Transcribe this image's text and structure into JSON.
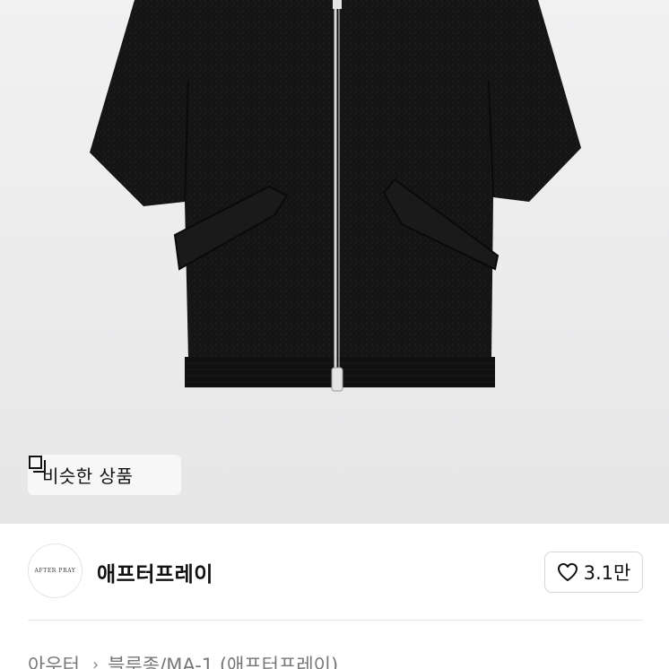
{
  "image": {
    "alt": ""
  },
  "similar_button": {
    "icon": "similar-items-icon",
    "label": "비슷한 상품"
  },
  "shop": {
    "logo_text": "AFTER PRAY",
    "name": "애프터프레이",
    "like_icon": "heart-outline-icon",
    "like_count": "3.1만"
  },
  "breadcrumb": {
    "category": "아우터",
    "separator": "›",
    "subcategory": "블루종/MA-1 (애프터프레이)"
  }
}
